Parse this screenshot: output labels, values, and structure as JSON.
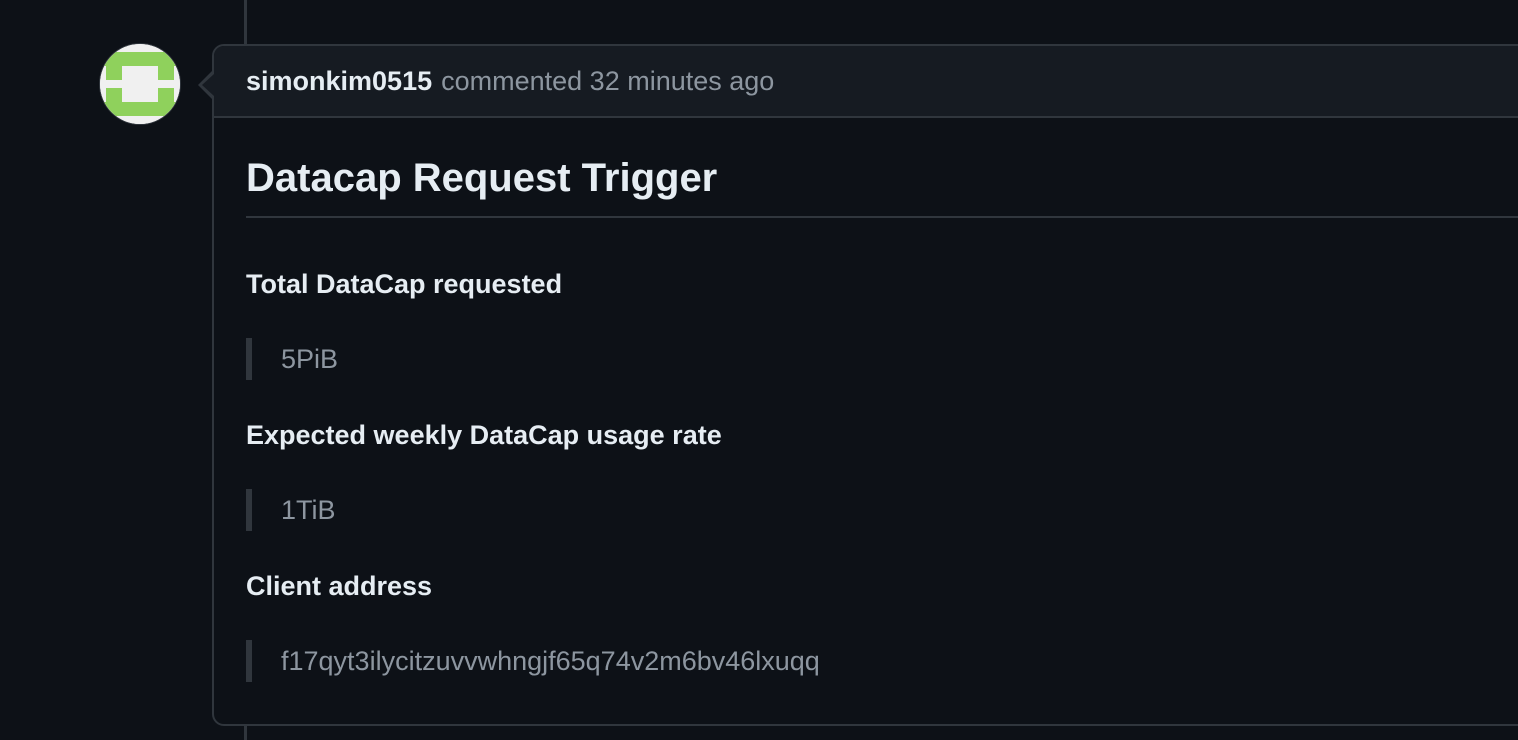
{
  "comment": {
    "author": "simonkim0515",
    "meta": "commented 32 minutes ago"
  },
  "body": {
    "title": "Datacap Request Trigger",
    "fields": [
      {
        "label": "Total DataCap requested",
        "value": "5PiB"
      },
      {
        "label": "Expected weekly DataCap usage rate",
        "value": "1TiB"
      },
      {
        "label": "Client address",
        "value": "f17qyt3ilycitzuvvwhngjf65q74v2m6bv46lxuqq"
      }
    ]
  },
  "colors": {
    "background": "#0d1117",
    "header_bg": "#161b22",
    "border": "#30363d",
    "text_primary": "#e6edf3",
    "text_muted": "#8d96a0",
    "avatar_green": "#8fd15c"
  },
  "icons": {
    "avatar": "identicon-avatar"
  }
}
